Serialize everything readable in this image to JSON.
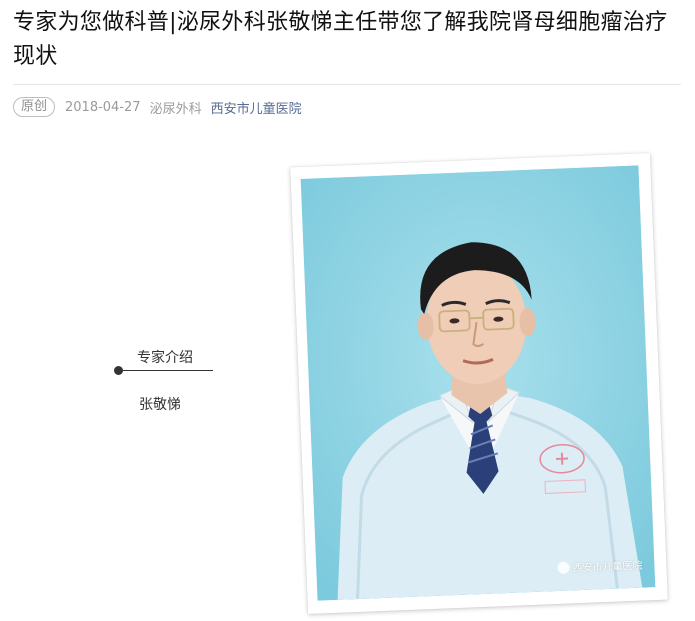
{
  "article": {
    "title": "专家为您做科普|泌尿外科张敬悌主任带您了解我院肾母细胞瘤治疗现状",
    "badge": "原创",
    "date": "2018-04-27",
    "category": "泌尿外科",
    "account": "西安市儿童医院"
  },
  "expert": {
    "section_label": "专家介绍",
    "name": "张敬悌"
  },
  "photo": {
    "watermark_text": "西安市儿童医院",
    "background_color": "#8fd3e3",
    "coat_color": "#d9edf5"
  },
  "colors": {
    "link": "#576b95",
    "meta": "#9a9a9a"
  }
}
